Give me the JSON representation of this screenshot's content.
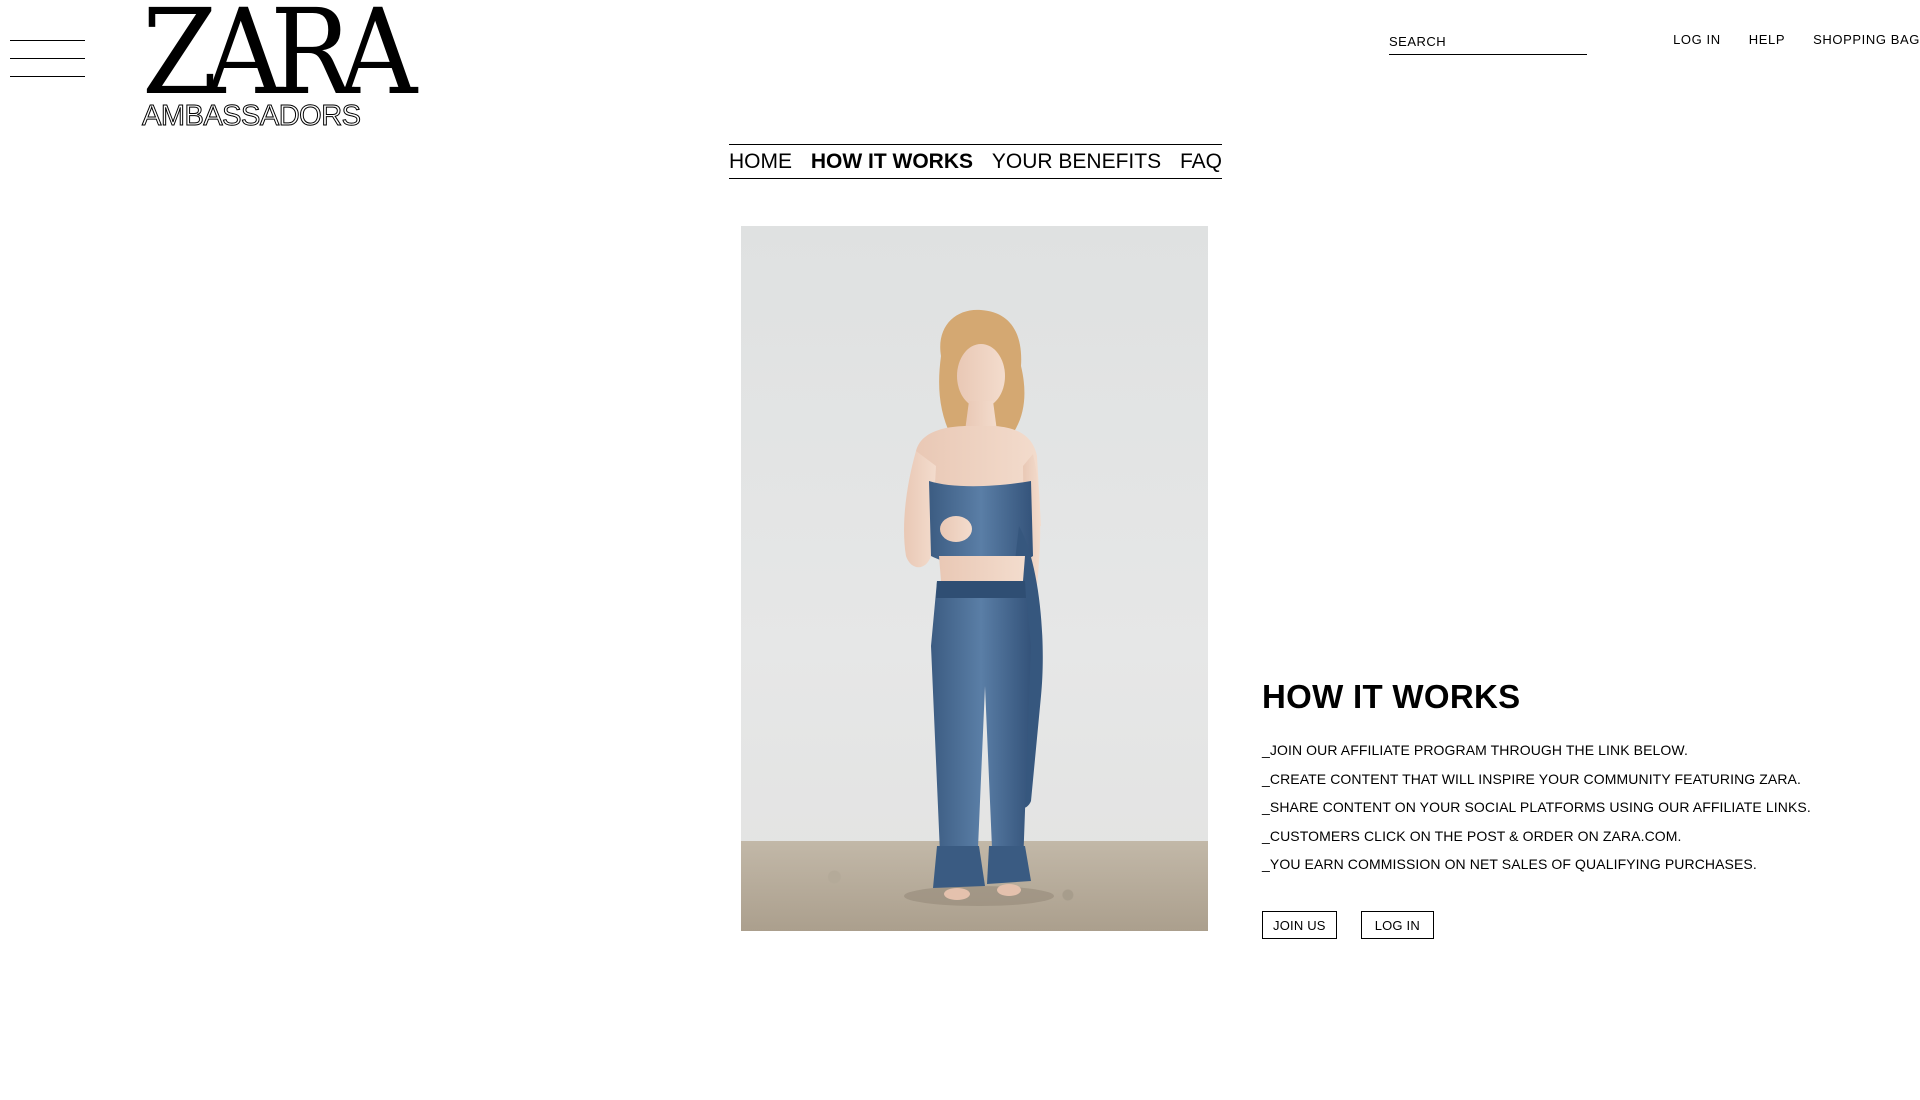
{
  "header": {
    "logo_text": "ZARA",
    "logo_sub": "AMBASSADORS",
    "search_placeholder": "SEARCH",
    "links": {
      "login": "LOG IN",
      "help": "HELP",
      "bag": "SHOPPING BAG"
    }
  },
  "subnav": {
    "items": [
      {
        "label": "HOME",
        "active": false
      },
      {
        "label": "HOW IT WORKS",
        "active": true
      },
      {
        "label": "YOUR BENEFITS",
        "active": false
      },
      {
        "label": "FAQ",
        "active": false
      }
    ]
  },
  "main": {
    "title": "HOW IT WORKS",
    "steps": [
      "_JOIN OUR AFFILIATE PROGRAM THROUGH THE LINK BELOW.",
      "_CREATE CONTENT THAT WILL INSPIRE YOUR COMMUNITY FEATURING ZARA.",
      "_SHARE CONTENT ON YOUR SOCIAL PLATFORMS USING OUR AFFILIATE LINKS.",
      "_CUSTOMERS CLICK ON THE POST & ORDER ON ZARA.COM.",
      "_YOU EARN COMMISSION ON NET SALES OF QUALIFYING PURCHASES."
    ],
    "buttons": {
      "join": "JOIN US",
      "login": "LOG IN"
    }
  },
  "icons": {
    "menu": "hamburger-menu-icon"
  },
  "colors": {
    "text": "#000000",
    "background": "#ffffff",
    "denim": "#41638a"
  }
}
